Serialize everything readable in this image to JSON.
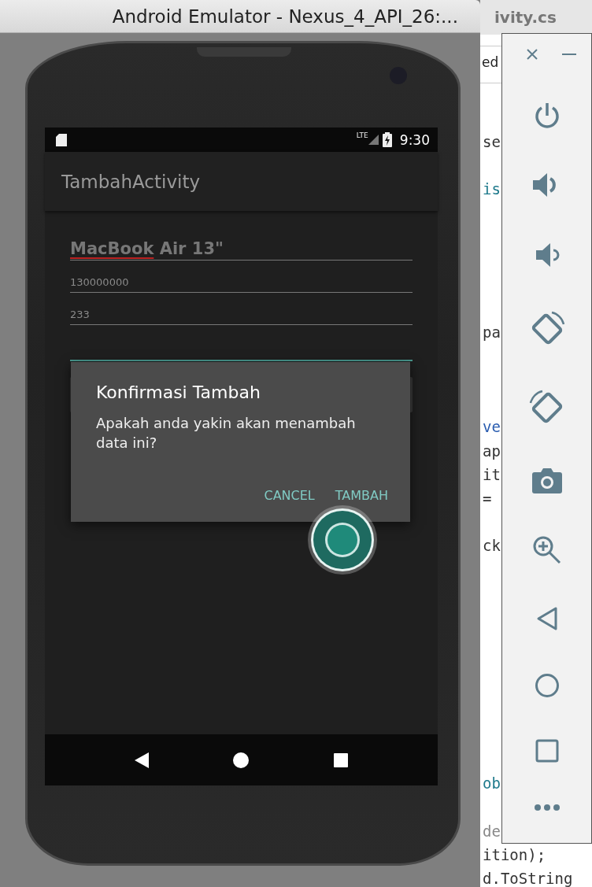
{
  "emulator_window": {
    "title": "Android Emulator - Nexus_4_API_26:..."
  },
  "background_editor": {
    "tab_title": "ivity.cs",
    "tab_fragment": "ed",
    "code_fragments": [
      {
        "text": "se",
        "color": "#333333"
      },
      {
        "text": "is",
        "color": "#1f7a8c"
      },
      {
        "text": "pa",
        "color": "#333333"
      },
      {
        "text": "ve",
        "color": "#2a5db0"
      },
      {
        "text": "ap",
        "color": "#333333"
      },
      {
        "text": "it",
        "color": "#333333"
      },
      {
        "text": "=",
        "color": "#333333"
      },
      {
        "text": "ck",
        "color": "#333333"
      },
      {
        "text": "ob",
        "color": "#1f7a8c"
      },
      {
        "text": "de",
        "color": "#888888"
      },
      {
        "text": "ition);",
        "color": "#333333"
      },
      {
        "text": "d.ToString",
        "color": "#333333"
      }
    ]
  },
  "status_bar": {
    "network": "LTE",
    "time": "9:30"
  },
  "app_bar": {
    "title": "TambahActivity"
  },
  "fields": [
    {
      "kind": "name",
      "segments": [
        {
          "text": "MacBook",
          "misspelled": true
        },
        {
          "text": " Air 13\"",
          "misspelled": false
        }
      ]
    },
    {
      "kind": "plain",
      "value": "130000000"
    },
    {
      "kind": "plain",
      "value": "233"
    }
  ],
  "dialog": {
    "title": "Konfirmasi Tambah",
    "message": "Apakah anda yakin akan menambah data ini?",
    "buttons": [
      "CANCEL",
      "TAMBAH"
    ]
  }
}
